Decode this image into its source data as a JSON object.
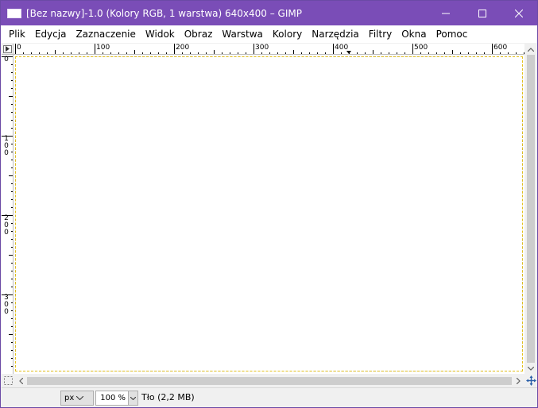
{
  "window": {
    "title": "[Bez nazwy]-1.0 (Kolory RGB, 1 warstwa) 640x400 – GIMP",
    "accent_color": "#7a4db7"
  },
  "menubar": {
    "items": [
      {
        "label": "Plik"
      },
      {
        "label": "Edycja"
      },
      {
        "label": "Zaznaczenie"
      },
      {
        "label": "Widok"
      },
      {
        "label": "Obraz"
      },
      {
        "label": "Warstwa"
      },
      {
        "label": "Kolory"
      },
      {
        "label": "Narzędzia"
      },
      {
        "label": "Filtry"
      },
      {
        "label": "Okna"
      },
      {
        "label": "Pomoc"
      }
    ]
  },
  "rulers": {
    "horizontal_labels": [
      "0",
      "100",
      "200",
      "300",
      "400",
      "500",
      "600"
    ],
    "vertical_labels": [
      "0",
      "100",
      "200",
      "300"
    ]
  },
  "statusbar": {
    "unit": "px",
    "zoom": "100 %",
    "layer_info": "Tło (2,2 MB)"
  },
  "icons": {
    "ruler_corner": "quick-mask-toggle-icon",
    "quick_mask": "quick-mask-icon",
    "navigate": "navigate-icon"
  }
}
